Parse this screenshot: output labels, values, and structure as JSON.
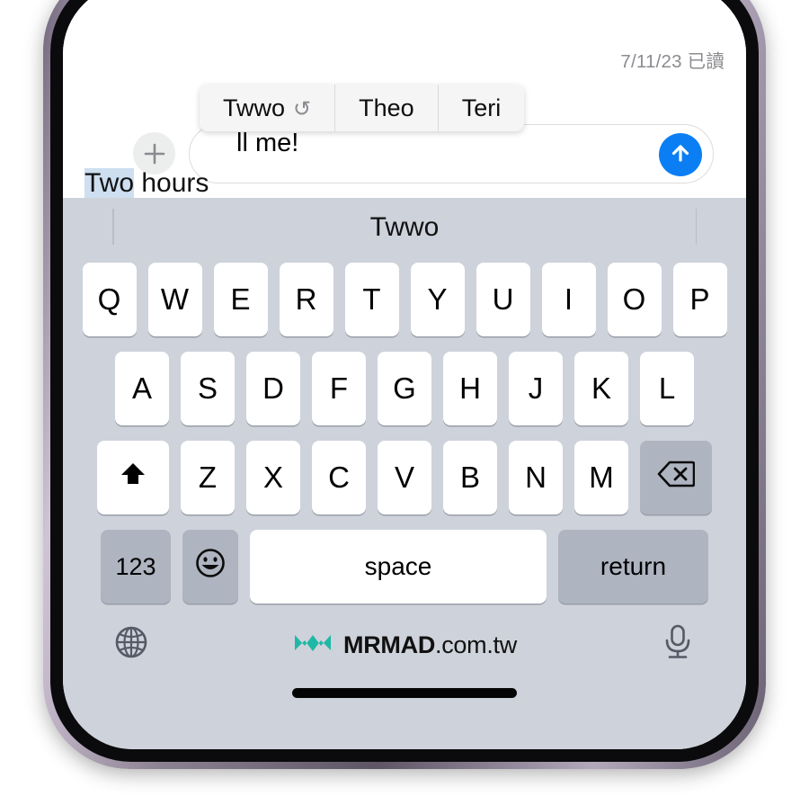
{
  "conversation": {
    "read_receipt": "7/11/23 已讀",
    "occluded_incoming_text": "ll me!"
  },
  "input_bar": {
    "plus_icon": "plus-icon",
    "send_icon": "arrow-up-icon",
    "composed_highlighted": "Two",
    "composed_rest": " hours"
  },
  "suggestion_popup": {
    "items": [
      {
        "label": "Twwo",
        "undo_glyph": "↺"
      },
      {
        "label": "Theo",
        "undo_glyph": ""
      },
      {
        "label": "Teri",
        "undo_glyph": ""
      }
    ]
  },
  "keyboard": {
    "prediction_word": "Twwo",
    "row1": [
      "Q",
      "W",
      "E",
      "R",
      "T",
      "Y",
      "U",
      "I",
      "O",
      "P"
    ],
    "row2": [
      "A",
      "S",
      "D",
      "F",
      "G",
      "H",
      "J",
      "K",
      "L"
    ],
    "row3_letters": [
      "Z",
      "X",
      "C",
      "V",
      "B",
      "N",
      "M"
    ],
    "shift_icon": "shift-arrow-icon",
    "backspace_icon": "backspace-delete-icon",
    "numbers_key": "123",
    "emoji_icon": "emoji-smiley-icon",
    "space_key": "space",
    "return_key": "return",
    "globe_icon": "globe-icon",
    "mic_icon": "microphone-icon"
  },
  "watermark": {
    "logo_icon": "mrmad-infinity-logo",
    "brand": "MRMAD",
    "domain": ".com.tw",
    "logo_color": "#1fb8a6"
  },
  "colors": {
    "send_blue": "#0b7ef4",
    "keyboard_bg": "#ced2da",
    "key_white": "#ffffff",
    "key_gray": "#aeb4c0",
    "highlight_blue": "#cddff0"
  }
}
